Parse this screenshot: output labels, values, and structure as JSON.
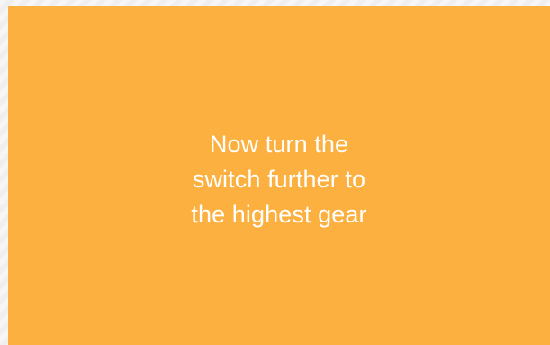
{
  "slide": {
    "background_color": "#fbb040",
    "text_color": "#ffffff",
    "message_lines": [
      "Now turn the",
      "switch further to",
      "the highest gear"
    ]
  }
}
